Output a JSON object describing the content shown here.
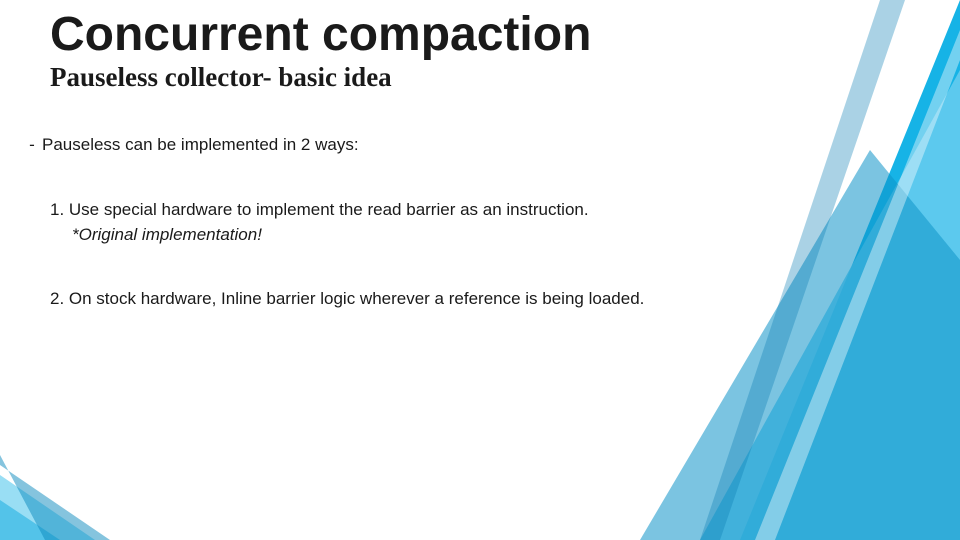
{
  "title": "Concurrent compaction",
  "subtitle": "Pauseless collector- basic idea",
  "bullet_dash": "-",
  "intro": "Pauseless can be implemented in 2 ways:",
  "item1": {
    "line": "1. Use special hardware to implement the read barrier as an instruction.",
    "note": "*Original implementation!"
  },
  "item2": {
    "line": "2. On stock hardware, Inline barrier logic wherever a reference is being loaded."
  }
}
